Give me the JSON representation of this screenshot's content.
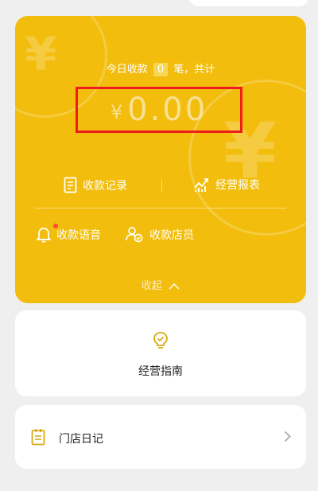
{
  "summary": {
    "today_prefix": "今日收款",
    "count": "0",
    "count_suffix": "笔，共计",
    "currency": "¥",
    "amount": "0.00"
  },
  "actions": {
    "records_label": "收款记录",
    "report_label": "经营报表",
    "voice_label": "收款语音",
    "staff_label": "收款店员"
  },
  "collapse_label": "收起",
  "guide": {
    "label": "经营指南"
  },
  "diary": {
    "label": "门店日记"
  },
  "colors": {
    "brand_yellow": "#f2bd0c",
    "highlight_red": "#ee1c1c",
    "notify_dot": "#ff4a3a",
    "icon_gold": "#d7ab12"
  },
  "icons": [
    "document-icon",
    "chart-line-icon",
    "bell-icon",
    "staff-icon",
    "chevron-up-icon",
    "lightbulb-icon",
    "notepad-icon",
    "chevron-right-icon"
  ]
}
